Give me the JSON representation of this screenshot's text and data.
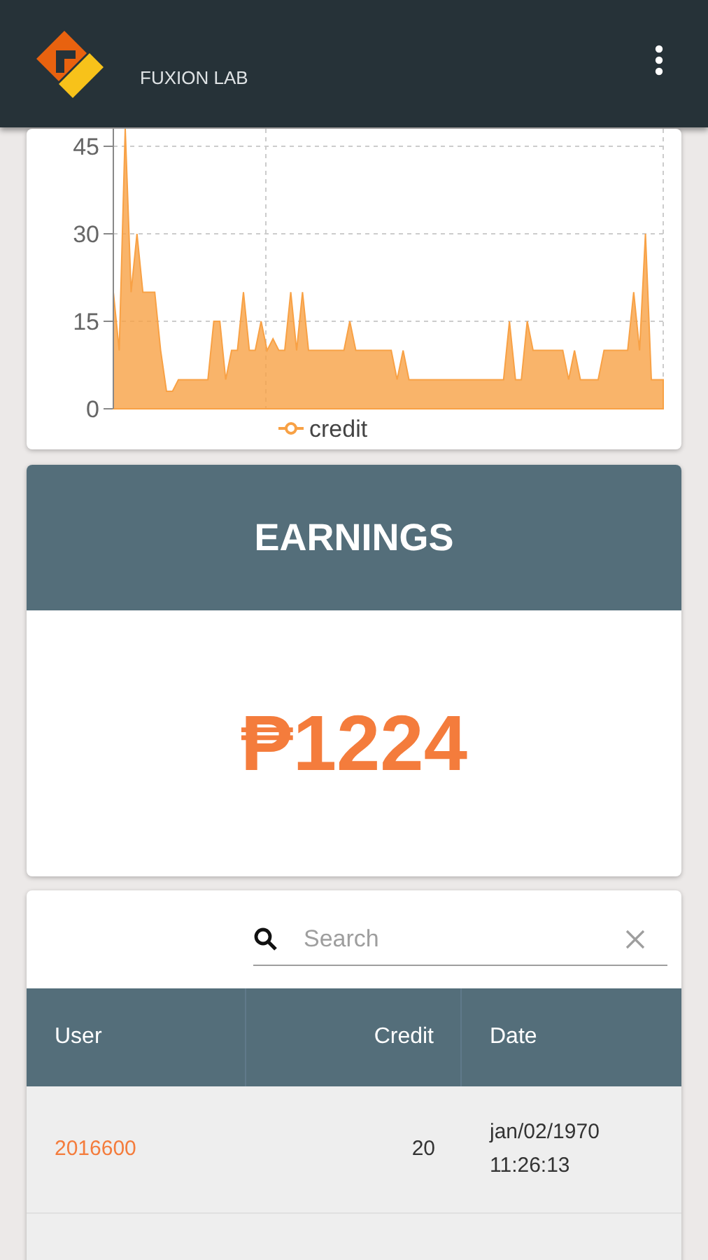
{
  "app_bar": {
    "title": "FUXION LAB"
  },
  "chart": {
    "chart_data": {
      "type": "area",
      "grid": true,
      "yticks": [
        0,
        15,
        30,
        45
      ],
      "ylim": [
        0,
        48
      ],
      "series": [
        {
          "name": "credit",
          "color": "#f8a145",
          "values": [
            20,
            10,
            48,
            20,
            30,
            20,
            20,
            20,
            10,
            3,
            3,
            5,
            5,
            5,
            5,
            5,
            5,
            15,
            15,
            5,
            10,
            10,
            20,
            10,
            10,
            15,
            10,
            12,
            10,
            10,
            20,
            10,
            20,
            10,
            10,
            10,
            10,
            10,
            10,
            10,
            15,
            10,
            10,
            10,
            10,
            10,
            10,
            10,
            5,
            10,
            5,
            5,
            5,
            5,
            5,
            5,
            5,
            5,
            5,
            5,
            5,
            5,
            5,
            5,
            5,
            5,
            5,
            15,
            5,
            5,
            15,
            10,
            10,
            10,
            10,
            10,
            10,
            5,
            10,
            5,
            5,
            5,
            5,
            10,
            10,
            10,
            10,
            10,
            20,
            10,
            30,
            5,
            5,
            5
          ]
        }
      ]
    }
  },
  "earnings": {
    "title": "EARNINGS",
    "amount": "₱1224"
  },
  "search": {
    "placeholder": "Search"
  },
  "table": {
    "columns": [
      "User",
      "Credit",
      "Date"
    ],
    "rows": [
      {
        "user": "2016600",
        "credit": "20",
        "date": "jan/02/1970 11:26:13"
      }
    ]
  }
}
